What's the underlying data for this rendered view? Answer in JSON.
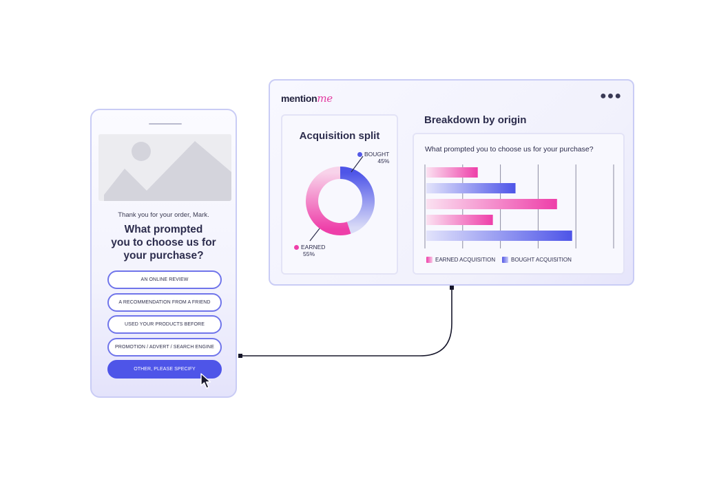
{
  "survey": {
    "thanks": "Thank you for your order, Mark.",
    "question": "What prompted\nyou to choose us for\nyour purchase?",
    "options": [
      {
        "label": "AN ONLINE REVIEW",
        "selected": false
      },
      {
        "label": "A RECOMMENDATION FROM A FRIEND",
        "selected": false
      },
      {
        "label": "USED YOUR PRODUCTS  BEFORE",
        "selected": false
      },
      {
        "label": "PROMOTION / ADVERT / SEARCH ENGINE",
        "selected": false
      },
      {
        "label": "OTHER, PLEASE SPECIFY",
        "selected": true
      }
    ]
  },
  "dashboard": {
    "logo_main": "mention",
    "logo_accent": "me",
    "more_icon": "more-horizontal-icon",
    "split_title": "Acquisition split",
    "origin_title": "Breakdown by origin",
    "origin_question": "What prompted you to choose us for your purchase?"
  },
  "colors": {
    "accent_blue": "#4e55e8",
    "accent_pink": "#e93aa8",
    "border": "#c9ccf5"
  },
  "chart_data": [
    {
      "type": "pie",
      "title": "Acquisition split",
      "slices": [
        {
          "name": "BOUGHT",
          "value": 45,
          "label": "45%",
          "color": "#5358e6"
        },
        {
          "name": "EARNED",
          "value": 55,
          "label": "55%",
          "color": "#ee3fa9"
        }
      ]
    },
    {
      "type": "bar",
      "orientation": "horizontal",
      "title": "Breakdown by origin",
      "subtitle": "What prompted you to choose us for your purchase?",
      "series": [
        {
          "name": "EARNED ACQUISITION",
          "color": "#ee3fa9"
        },
        {
          "name": "BOUGHT ACQUISITION",
          "color": "#5358e6"
        }
      ],
      "bars": [
        {
          "series": "EARNED ACQUISITION",
          "value": 1.4
        },
        {
          "series": "BOUGHT ACQUISITION",
          "value": 2.4
        },
        {
          "series": "EARNED ACQUISITION",
          "value": 3.5
        },
        {
          "series": "EARNED ACQUISITION",
          "value": 1.8
        },
        {
          "series": "BOUGHT ACQUISITION",
          "value": 3.9
        }
      ],
      "xlim": [
        0,
        5
      ],
      "grid": true,
      "legend": "bottom-left"
    }
  ]
}
